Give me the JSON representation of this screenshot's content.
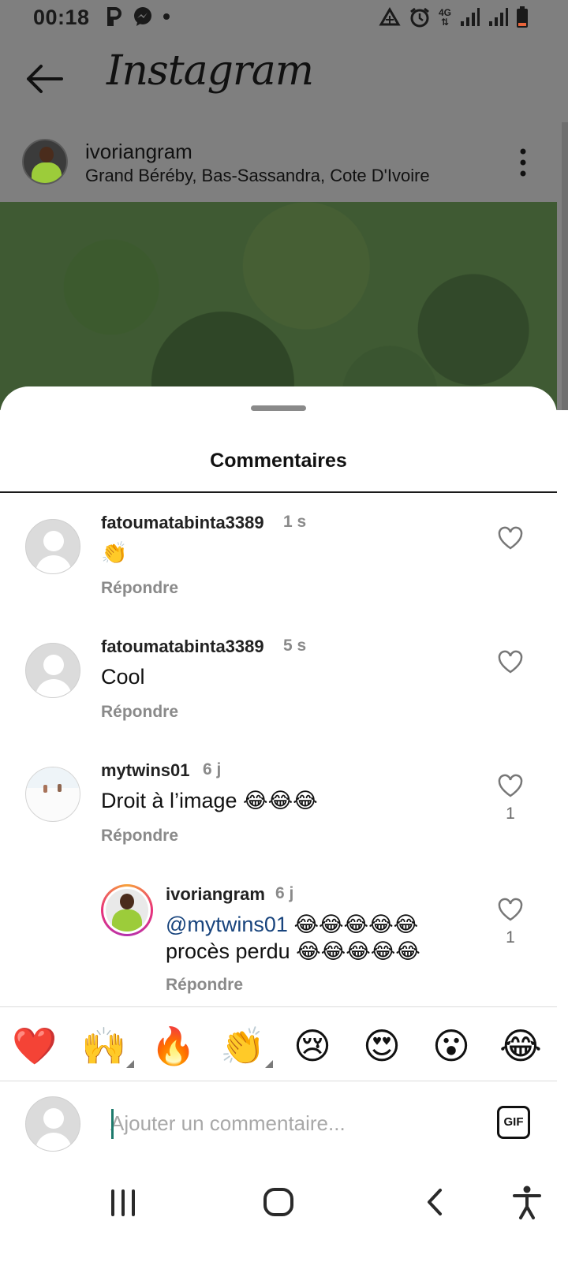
{
  "status_bar": {
    "time": "00:18",
    "network": "4G",
    "icons": [
      "parking-icon",
      "messenger-icon",
      "dot-icon",
      "data-saver-icon",
      "alarm-icon",
      "signal-icon",
      "battery-icon"
    ]
  },
  "app_bar": {
    "logo_text": "Instagram",
    "back_icon": "back-arrow-icon"
  },
  "post": {
    "username": "ivoriangram",
    "location": "Grand Béréby, Bas-Sassandra, Cote D'Ivoire",
    "more_icon": "more-vertical-icon"
  },
  "sheet": {
    "title": "Commentaires"
  },
  "comments": [
    {
      "username": "fatoumatabinta3389",
      "time": "1 s",
      "text": "👏",
      "reply_label": "Répondre",
      "likes": ""
    },
    {
      "username": "fatoumatabinta3389",
      "time": "5 s",
      "text": "Cool",
      "reply_label": "Répondre",
      "likes": ""
    },
    {
      "username": "mytwins01",
      "time": "6 j",
      "text": "Droit à l’image 😂😂😂",
      "reply_label": "Répondre",
      "likes": "1"
    },
    {
      "username": "ivoriangram",
      "time": "6 j",
      "mention": "@mytwins01",
      "text_line1_rest": " 😂😂😂😂😂",
      "text_line2": "procès perdu 😂😂😂😂😂",
      "reply_label": "Répondre",
      "likes": "1"
    }
  ],
  "quick_emojis": [
    "❤️",
    "🙌",
    "🔥",
    "👏",
    "😢",
    "😍",
    "😮",
    "😂"
  ],
  "input": {
    "placeholder": "Ajouter un commentaire...",
    "value": "",
    "gif_label": "GIF"
  },
  "nav_bar": {
    "icons": [
      "recent-apps-icon",
      "home-icon",
      "back-icon",
      "accessibility-icon"
    ]
  },
  "colors": {
    "mention": "#18447d",
    "meta_gray": "#8a8a8a",
    "overlay": "#7f7f7f"
  }
}
